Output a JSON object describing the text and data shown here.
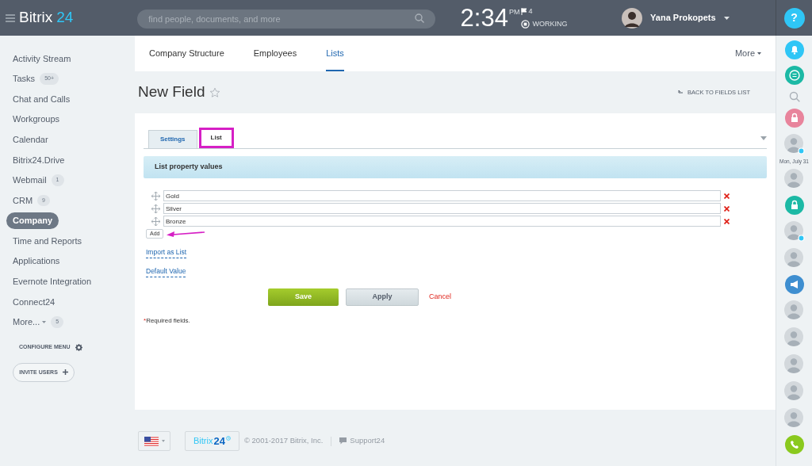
{
  "header": {
    "logo_name": "Bitrix",
    "logo_number": "24",
    "search": {
      "placeholder": "find people, documents, and more"
    },
    "time": "2:34",
    "ampm": "PM",
    "flags": "4",
    "work_status": "WORKING",
    "user": "Yana Prokopets",
    "help": "?"
  },
  "sidebar": {
    "items": [
      {
        "label": "Activity Stream",
        "selected": false
      },
      {
        "label": "Tasks",
        "counter": "50+",
        "selected": false
      },
      {
        "label": "Chat and Calls",
        "selected": false
      },
      {
        "label": "Workgroups",
        "selected": false
      },
      {
        "label": "Calendar",
        "selected": false
      },
      {
        "label": "Bitrix24.Drive",
        "selected": false
      },
      {
        "label": "Webmail",
        "counter": "1",
        "selected": false
      },
      {
        "label": "CRM",
        "counter": "9",
        "selected": false
      },
      {
        "label": "Company",
        "selected": true
      },
      {
        "label": "Time and Reports",
        "selected": false
      },
      {
        "label": "Applications",
        "selected": false
      },
      {
        "label": "Evernote Integration",
        "selected": false
      },
      {
        "label": "Connect24",
        "selected": false
      },
      {
        "label": "More...",
        "counter": "5",
        "selected": false,
        "dropdown": true
      }
    ],
    "configure": "CONFIGURE MENU",
    "invite": "INVITE USERS"
  },
  "nav_tabs": [
    {
      "label": "Company Structure",
      "selected": false
    },
    {
      "label": "Employees",
      "selected": false
    },
    {
      "label": "Lists",
      "selected": true
    }
  ],
  "nav_more": "More",
  "page_title": "New Field",
  "back_link": "BACK TO FIELDS LIST",
  "form_tabs": [
    {
      "label": "Settings",
      "selected": false
    },
    {
      "label": "List",
      "selected": true
    }
  ],
  "section_title": "List property values",
  "values": [
    {
      "value": "Gold"
    },
    {
      "value": "Silver"
    },
    {
      "value": "Bronze"
    }
  ],
  "add_button": "Add",
  "links": [
    "Import as List",
    "Default Value"
  ],
  "buttons": {
    "save": "Save",
    "apply": "Apply",
    "cancel": "Cancel"
  },
  "required_mark": "*",
  "required_note": "Required fields.",
  "right_bar": {
    "items": [
      {
        "kind": "bell"
      },
      {
        "kind": "chat"
      },
      {
        "kind": "search"
      },
      {
        "kind": "lock",
        "color": "#e8849c"
      },
      {
        "kind": "avatar",
        "online": true
      },
      {
        "kind": "date",
        "text": "Mon, July 31"
      },
      {
        "kind": "avatar",
        "online": false
      },
      {
        "kind": "lock",
        "color": "#1cb9a5"
      },
      {
        "kind": "avatar",
        "online": true
      },
      {
        "kind": "avatar",
        "online": false
      },
      {
        "kind": "megaphone"
      },
      {
        "kind": "avatar",
        "online": false
      },
      {
        "kind": "avatar",
        "online": false
      },
      {
        "kind": "avatar",
        "online": false
      },
      {
        "kind": "avatar",
        "online": false
      },
      {
        "kind": "avatar",
        "online": false
      },
      {
        "kind": "phone"
      }
    ]
  },
  "footer": {
    "logo_name": "Bitrix",
    "logo_number": "24",
    "copyright": "© 2001-2017 Bitrix, Inc.",
    "support": "Support24"
  }
}
